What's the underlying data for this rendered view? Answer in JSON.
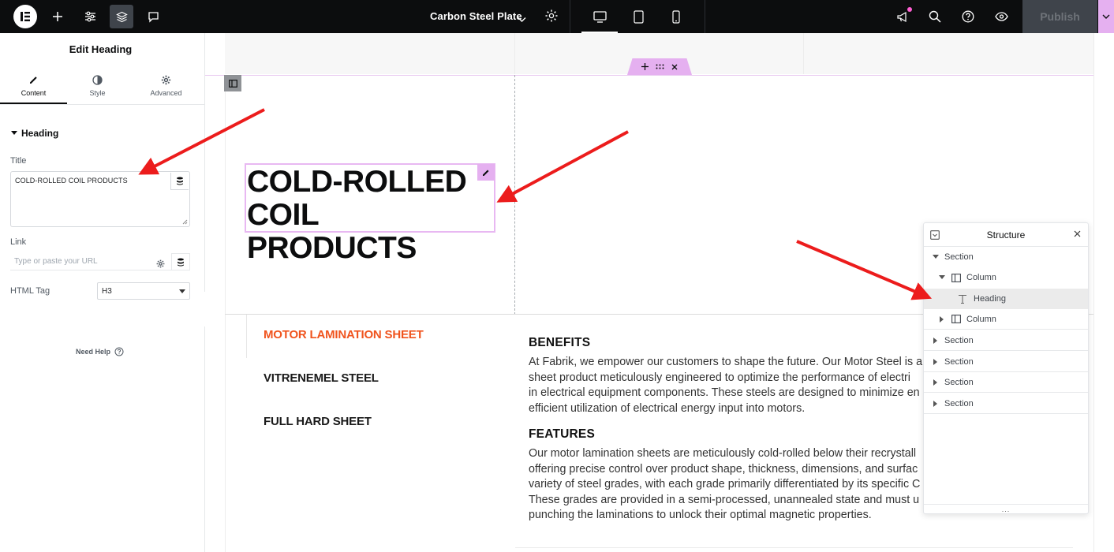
{
  "topbar": {
    "page_title": "Carbon Steel Plate",
    "publish_label": "Publish",
    "icons": [
      "elementor-logo-icon",
      "plus-icon",
      "sliders-icon",
      "layers-icon",
      "comment-icon",
      "chevron-down-icon",
      "gear-icon",
      "desktop-icon",
      "tablet-icon",
      "mobile-icon",
      "megaphone-icon",
      "search-icon",
      "help-icon",
      "eye-icon",
      "chevron-down-icon"
    ],
    "brand_accent": "#e5b0f0"
  },
  "panel": {
    "title": "Edit Heading",
    "tabs": [
      {
        "label": "Content",
        "icon": "pencil-icon"
      },
      {
        "label": "Style",
        "icon": "contrast-icon"
      },
      {
        "label": "Advanced",
        "icon": "gear-icon"
      }
    ],
    "section_label": "Heading",
    "title_label": "Title",
    "title_value": "COLD-ROLLED COIL PRODUCTS",
    "link_label": "Link",
    "link_placeholder": "Type or paste your URL",
    "html_tag_label": "HTML Tag",
    "html_tag_value": "H3",
    "need_help": "Need Help"
  },
  "canvas": {
    "heading_line1": "COLD-ROLLED",
    "heading_line2": "COIL PRODUCTS",
    "tabs": [
      {
        "label": "MOTOR LAMINATION SHEET",
        "active": true
      },
      {
        "label": "VITRENEMEL STEEL",
        "active": false
      },
      {
        "label": "FULL HARD SHEET",
        "active": false
      }
    ],
    "active_tab_color": "#f0541e",
    "benefits_title": "BENEFITS",
    "benefits_lines": [
      "At Fabrik, we empower our customers to shape the future. Our Motor Steel is a",
      "sheet product meticulously engineered to optimize the performance of electri",
      "in electrical equipment components. These steels are designed to minimize en",
      "efficient utilization of electrical energy input into motors."
    ],
    "features_title": "FEATURES",
    "features_lines": [
      "Our motor lamination sheets are meticulously cold-rolled below their recrystall",
      "offering precise control over product shape, thickness, dimensions, and surfac",
      "variety of steel grades, with each grade primarily differentiated by its specific C",
      "These grades are provided in a semi-processed, unannealed state and must u",
      "punching the laminations to unlock their optimal magnetic properties."
    ]
  },
  "structure": {
    "title": "Structure",
    "items": [
      {
        "label": "Section",
        "level": 0,
        "expanded": true,
        "icon": ""
      },
      {
        "label": "Column",
        "level": 1,
        "expanded": true,
        "icon": "column-icon"
      },
      {
        "label": "Heading",
        "level": 2,
        "selected": true,
        "icon": "heading-icon"
      },
      {
        "label": "Column",
        "level": 1,
        "expanded": false,
        "icon": "column-icon"
      },
      {
        "label": "Section",
        "level": 0,
        "expanded": false,
        "icon": ""
      },
      {
        "label": "Section",
        "level": 0,
        "expanded": false,
        "icon": ""
      },
      {
        "label": "Section",
        "level": 0,
        "expanded": false,
        "icon": ""
      },
      {
        "label": "Section",
        "level": 0,
        "expanded": false,
        "icon": ""
      }
    ],
    "footer": "..."
  }
}
